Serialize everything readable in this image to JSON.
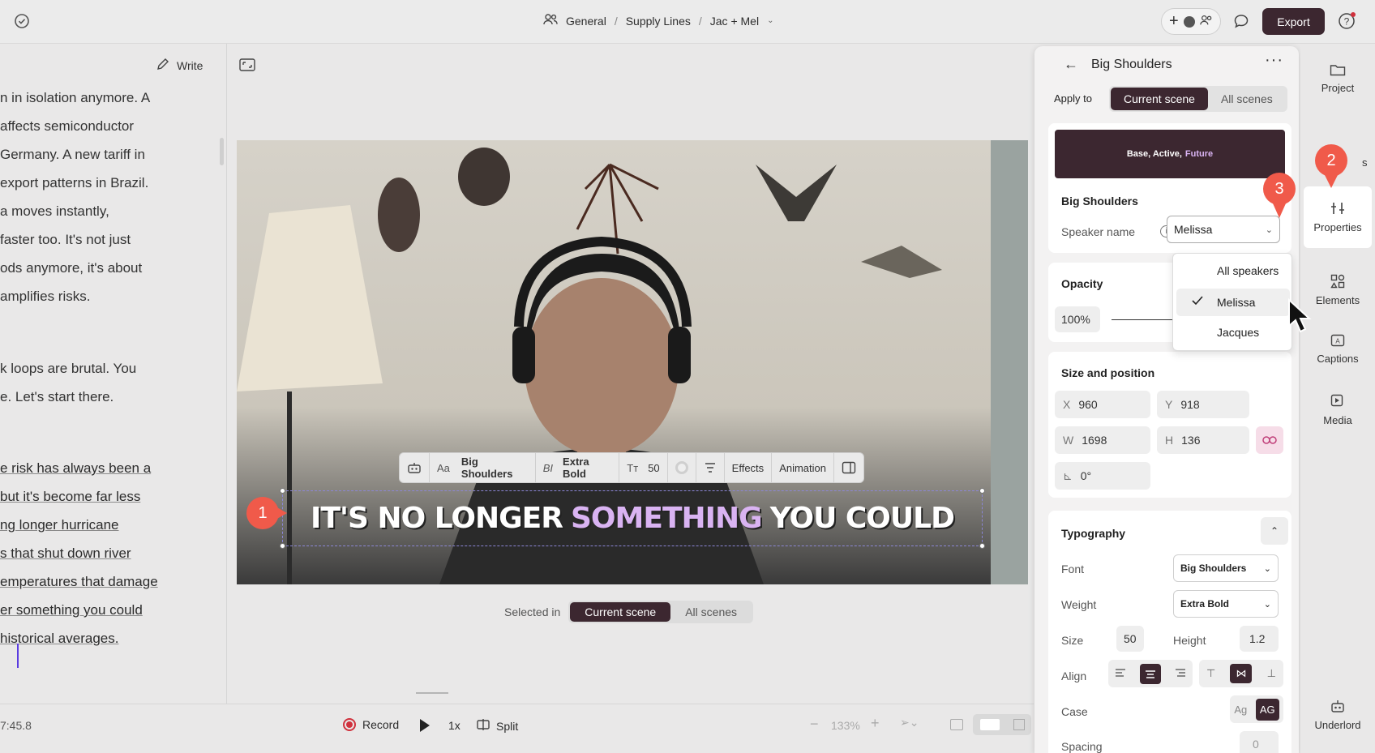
{
  "topbar": {
    "crumbs": [
      "General",
      "Supply Lines",
      "Jac + Mel"
    ],
    "export_label": "Export"
  },
  "script": {
    "write_label": "Write",
    "lines": [
      "n in isolation anymore. A",
      "affects semiconductor",
      "Germany. A new tariff in",
      "export patterns in Brazil.",
      "a moves instantly,",
      " faster too. It's not just",
      "ods anymore, it's about",
      "amplifies risks.",
      "k loops are brutal. You",
      "e. Let's start there."
    ],
    "underlined_lines": [
      "e risk has always been a",
      " but it's become far less",
      "ng longer hurricane",
      "s that shut down river",
      "emperatures that damage",
      "er something you could",
      "historical averages."
    ]
  },
  "video": {
    "caption_before": "IT'S NO LONGER",
    "caption_highlight": "SOMETHING",
    "caption_after": "YOU COULD"
  },
  "text_toolbar": {
    "font_icon_label": "Aa",
    "font": "Big Shoulders",
    "style_icon": "BI",
    "weight": "Extra Bold",
    "size": "50",
    "effects": "Effects",
    "animation": "Animation"
  },
  "selected_in": {
    "label": "Selected in",
    "options": [
      "Current scene",
      "All scenes"
    ],
    "active": "Current scene"
  },
  "bottombar": {
    "timecode": "7:45.8",
    "record": "Record",
    "speed": "1x",
    "split": "Split",
    "zoom": "133%"
  },
  "props": {
    "title": "Big Shoulders",
    "apply_to_label": "Apply to",
    "apply_options": [
      "Current scene",
      "All scenes"
    ],
    "preview_parts": [
      "Base, Active,",
      "Future"
    ],
    "section_name": "Big Shoulders",
    "speaker_label": "Speaker name",
    "speaker_value": "Melissa",
    "opacity_label": "Opacity",
    "opacity_value": "100%",
    "size_pos_label": "Size and position",
    "x_key": "X",
    "x_val": "960",
    "y_key": "Y",
    "y_val": "918",
    "w_key": "W",
    "w_val": "1698",
    "h_key": "H",
    "h_val": "136",
    "rotation": "0°",
    "typography_label": "Typography",
    "font_label": "Font",
    "font_value": "Big Shoulders",
    "weight_label": "Weight",
    "weight_value": "Extra Bold",
    "size_label": "Size",
    "size_value": "50",
    "height_label": "Height",
    "height_value": "1.2",
    "align_label": "Align",
    "case_label": "Case",
    "case_opt1": "Ag",
    "case_opt2": "AG",
    "spacing_label": "Spacing",
    "spacing_value": "0"
  },
  "dropdown": {
    "options": [
      "All speakers",
      "Melissa",
      "Jacques"
    ],
    "selected": "Melissa"
  },
  "rail": {
    "items": [
      "Project",
      "Properties",
      "Elements",
      "Captions",
      "Media",
      "Underlord"
    ],
    "partial_label": "s"
  },
  "markers": [
    "1",
    "2",
    "3"
  ],
  "colors": {
    "accent": "#3c2730",
    "highlight": "#d9b3f2",
    "marker": "#f05a4a",
    "link": "#c0407a"
  }
}
